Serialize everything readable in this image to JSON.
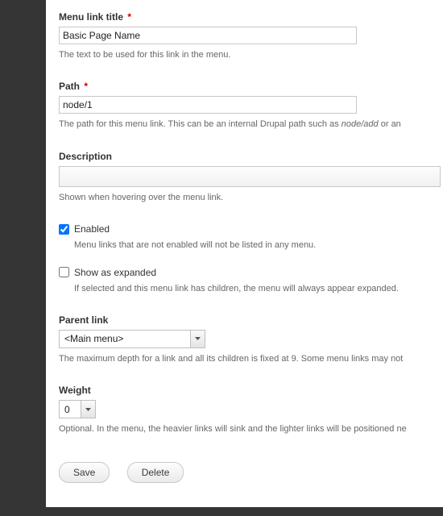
{
  "menu_link_title": {
    "label": "Menu link title",
    "required": "*",
    "value": "Basic Page Name",
    "description": "The text to be used for this link in the menu."
  },
  "path": {
    "label": "Path",
    "required": "*",
    "value": "node/1",
    "description_pre": "The path for this menu link. This can be an internal Drupal path such as ",
    "description_em": "node/add",
    "description_post": " or an "
  },
  "description_field": {
    "label": "Description",
    "value": "",
    "description": "Shown when hovering over the menu link."
  },
  "enabled": {
    "label": "Enabled",
    "checked": true,
    "description": "Menu links that are not enabled will not be listed in any menu."
  },
  "show_as_expanded": {
    "label": "Show as expanded",
    "checked": false,
    "description": "If selected and this menu link has children, the menu will always appear expanded."
  },
  "parent_link": {
    "label": "Parent link",
    "value": "<Main menu>",
    "description": "The maximum depth for a link and all its children is fixed at 9. Some menu links may not "
  },
  "weight": {
    "label": "Weight",
    "value": "0",
    "description": "Optional. In the menu, the heavier links will sink and the lighter links will be positioned ne"
  },
  "buttons": {
    "save": "Save",
    "delete": "Delete"
  }
}
